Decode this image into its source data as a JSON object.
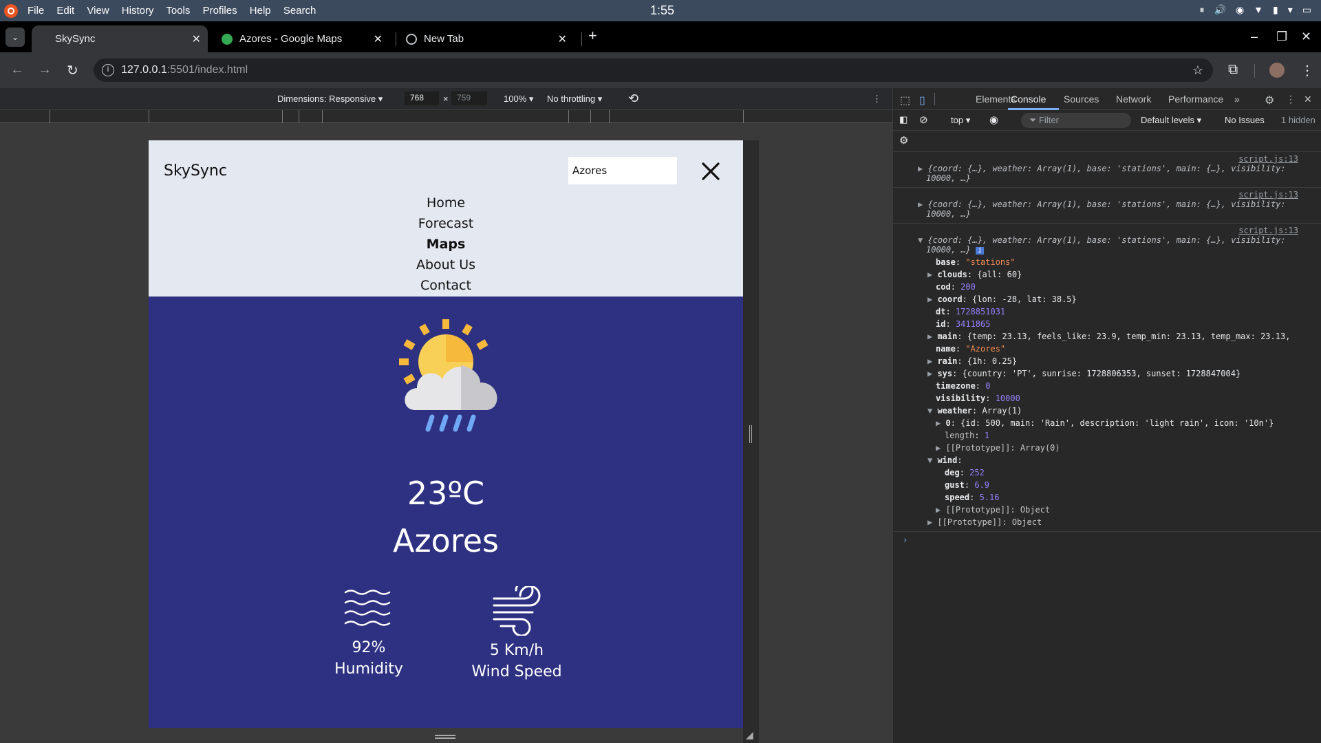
{
  "os_bar": {
    "menu": [
      "File",
      "Edit",
      "View",
      "History",
      "Tools",
      "Profiles",
      "Help",
      "Search"
    ],
    "clock": "1:55"
  },
  "browser": {
    "tabs": [
      {
        "title": "SkySync",
        "active": true
      },
      {
        "title": "Azores - Google Maps",
        "active": false
      },
      {
        "title": "New Tab",
        "active": false
      }
    ],
    "url_host": "127.0.0.1",
    "url_rest": ":5501/index.html"
  },
  "device_toolbar": {
    "dimensions": "Dimensions: Responsive",
    "width": "768",
    "height": "759",
    "zoom": "100%",
    "throttling": "No throttling"
  },
  "page": {
    "brand": "SkySync",
    "search_value": "Azores",
    "nav": [
      "Home",
      "Forecast",
      "Maps",
      "About Us",
      "Contact"
    ],
    "active_nav": "Maps",
    "temperature": "23ºC",
    "city": "Azores",
    "humidity_value": "92%",
    "humidity_label": "Humidity",
    "wind_value": "5 Km/h",
    "wind_label": "Wind Speed"
  },
  "devtools": {
    "tabs": [
      "Elements",
      "Console",
      "Sources",
      "Network",
      "Performance"
    ],
    "active_tab": "Console",
    "context": "top",
    "filter_placeholder": "Filter",
    "levels": "Default levels",
    "issues": "No Issues",
    "hidden": "1 hidden",
    "source_link": "script.js:13",
    "collapsed_line1": "{coord: {…}, weather: Array(1), base: 'stations', main: {…}, visibility:",
    "collapsed_line2": "10000, …}",
    "props": {
      "base": "\"stations\"",
      "clouds": "{all: 60}",
      "cod": "200",
      "coord": "{lon: -28, lat: 38.5}",
      "dt": "1728851031",
      "id": "3411865",
      "main": "{temp: 23.13, feels_like: 23.9, temp_min: 23.13, temp_max: 23.13,",
      "name": "\"Azores\"",
      "rain": "{1h: 0.25}",
      "sys": "{country: 'PT', sunrise: 1728806353, sunset: 1728847004}",
      "timezone": "0",
      "visibility": "10000",
      "weather": "Array(1)",
      "weather_0": "{id: 500, main: 'Rain', description: 'light rain', icon: '10n'}",
      "length": "1",
      "proto_array": "[[Prototype]]: Array(0)",
      "wind_deg": "252",
      "wind_gust": "6.9",
      "wind_speed": "5.16",
      "proto_object": "[[Prototype]]: Object"
    }
  }
}
